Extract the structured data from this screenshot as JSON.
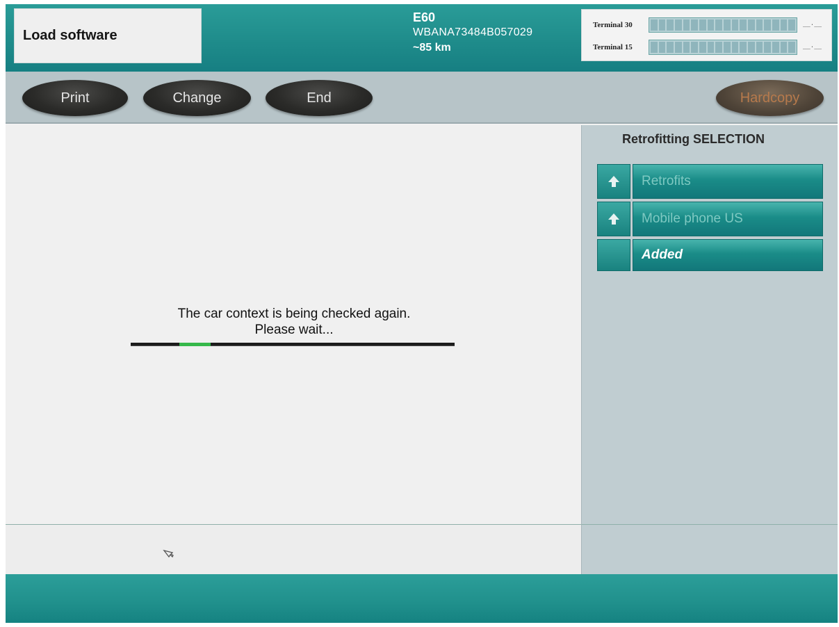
{
  "header": {
    "title": "Load software",
    "vehicle": {
      "model": "E60",
      "vin": "WBANA73484B057029",
      "mileage": "~85 km"
    },
    "terminals": [
      {
        "label": "Terminal 30",
        "value": "__·__"
      },
      {
        "label": "Terminal 15",
        "value": "__·__"
      }
    ]
  },
  "toolbar": {
    "print_label": "Print",
    "change_label": "Change",
    "end_label": "End",
    "hardcopy_label": "Hardcopy"
  },
  "main": {
    "message_line1": "The car context is being checked again.",
    "message_line2": "Please wait...",
    "progress_fraction": 0.15
  },
  "side": {
    "heading": "Retrofitting SELECTION",
    "items": [
      {
        "label": "Retrofits",
        "icon": "arrow-up-icon"
      },
      {
        "label": "Mobile phone US",
        "icon": "arrow-up-icon"
      },
      {
        "label": "Added",
        "icon": ""
      }
    ]
  },
  "colors": {
    "teal": "#1f8c8b",
    "button_dark": "#2b2b29",
    "progress": "#35b84a"
  }
}
